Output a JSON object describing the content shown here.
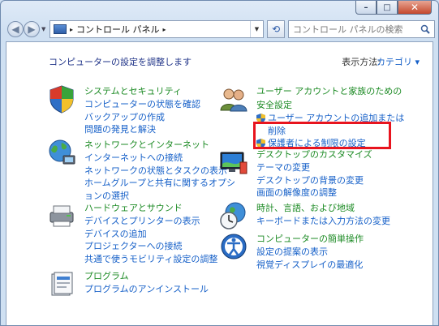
{
  "window": {
    "minimize_symbol": "–",
    "maximize_symbol": "□",
    "close_symbol": "✕"
  },
  "toolbar": {
    "address_separator": "▸",
    "breadcrumb": "コントロール パネル",
    "search_placeholder": "コントロール パネルの検索"
  },
  "main": {
    "heading": "コンピューターの設定を調整します",
    "view_by_label": "表示方法:",
    "view_by_value": "カテゴリ ▾"
  },
  "categories_left": [
    {
      "icon": "system-security-icon",
      "title": "システムとセキュリティ",
      "links": [
        "コンピューターの状態を確認",
        "バックアップの作成",
        "問題の発見と解決"
      ]
    },
    {
      "icon": "network-internet-icon",
      "title": "ネットワークとインターネット",
      "links": [
        "インターネットへの接続",
        "ネットワークの状態とタスクの表示",
        "ホームグループと共有に関するオプシ",
        "ョンの選択"
      ]
    },
    {
      "icon": "hardware-sound-icon",
      "title": "ハードウェアとサウンド",
      "links": [
        "デバイスとプリンターの表示",
        "デバイスの追加",
        "プロジェクターへの接続",
        "共通で使うモビリティ設定の調整"
      ]
    },
    {
      "icon": "programs-icon",
      "title": "プログラム",
      "links": [
        "プログラムのアンインストール"
      ]
    }
  ],
  "categories_right": [
    {
      "icon": "user-accounts-icon",
      "title": "ユーザー アカウントと家族のための",
      "title2": "安全設定",
      "links": [
        "ユーザー アカウントの追加または",
        "削除",
        "保護者による制限の設定"
      ]
    },
    {
      "icon": "appearance-icon",
      "title": "デスクトップのカスタマイズ",
      "links": [
        "テーマの変更",
        "デスクトップの背景の変更",
        "画面の解像度の調整"
      ]
    },
    {
      "icon": "clock-region-icon",
      "title": "時計、言語、および地域",
      "links": [
        "キーボードまたは入力方法の変更"
      ]
    },
    {
      "icon": "ease-of-access-icon",
      "title": "コンピューターの簡単操作",
      "links": [
        "設定の提案の表示",
        "視覚ディスプレイの最適化"
      ]
    }
  ],
  "colors": {
    "category_title": "#1b8a23",
    "link": "#1660c8",
    "heading": "#1e3287",
    "highlight": "#e8141e"
  }
}
